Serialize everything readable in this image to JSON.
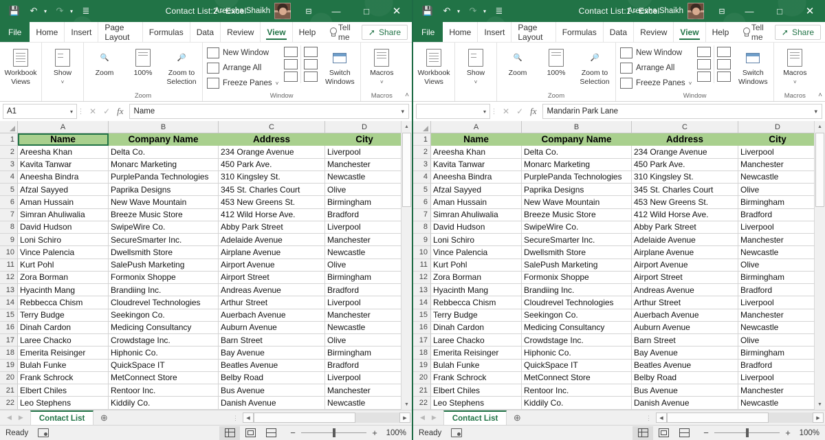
{
  "windows": [
    {
      "title": "Contact List:2  -  Excel",
      "user": "Areesha Shaikh",
      "name_box": "A1",
      "formula_value": "Name",
      "selected_cell": "A1"
    },
    {
      "title": "Contact List:1  -  Excel",
      "user": "Areesha Shaikh",
      "name_box": "",
      "formula_value": "Mandarin Park Lane",
      "selected_cell": ""
    }
  ],
  "quick_access": {
    "save_icon": "save-icon",
    "undo_icon": "undo-icon",
    "redo_icon": "redo-icon",
    "customize_icon": "customize-qat-icon"
  },
  "window_controls": {
    "ribbon_display_options": "ribbon-display-options-icon",
    "minimize": "—",
    "maximize": "□",
    "close": "✕"
  },
  "ribbon_tabs": [
    {
      "label": "File",
      "active": false
    },
    {
      "label": "Home",
      "active": false
    },
    {
      "label": "Insert",
      "active": false
    },
    {
      "label": "Page Layout",
      "active": false
    },
    {
      "label": "Formulas",
      "active": false
    },
    {
      "label": "Data",
      "active": false
    },
    {
      "label": "Review",
      "active": false
    },
    {
      "label": "View",
      "active": true
    },
    {
      "label": "Help",
      "active": false
    }
  ],
  "tell_me": "Tell me",
  "share_label": "Share",
  "ribbon_groups": {
    "workbook_views": {
      "label": "",
      "button": {
        "line1": "Workbook",
        "line2": "Views",
        "caret": "˅"
      }
    },
    "show": {
      "button": {
        "line1": "Show",
        "caret": "˅"
      }
    },
    "zoom": {
      "label": "Zoom",
      "buttons": [
        {
          "label": "Zoom"
        },
        {
          "label": "100%"
        },
        {
          "line1": "Zoom to",
          "line2": "Selection"
        }
      ]
    },
    "window": {
      "label": "Window",
      "small_buttons": [
        {
          "label": "New Window"
        },
        {
          "label": "Arrange All"
        },
        {
          "label": "Freeze Panes",
          "caret": "˅"
        }
      ],
      "switch_windows": {
        "line1": "Switch",
        "line2": "Windows",
        "caret": "˅"
      }
    },
    "macros": {
      "label": "Macros",
      "button": {
        "line1": "Macros",
        "caret": "˅"
      }
    }
  },
  "collapse_ribbon": "˄",
  "sheet": {
    "columns": [
      "A",
      "B",
      "C",
      "D"
    ],
    "headers": [
      "Name",
      "Company Name",
      "Address",
      "City"
    ],
    "rows": [
      {
        "n": 2,
        "cells": [
          "Areesha Khan",
          "Delta Co.",
          "234 Orange Avenue",
          "Liverpool"
        ]
      },
      {
        "n": 3,
        "cells": [
          "Kavita Tanwar",
          "Monarc Marketing",
          "450 Park Ave.",
          "Manchester"
        ]
      },
      {
        "n": 4,
        "cells": [
          "Aneesha Bindra",
          "PurplePanda Technologies",
          "310 Kingsley St.",
          "Newcastle"
        ]
      },
      {
        "n": 5,
        "cells": [
          "Afzal Sayyed",
          "Paprika Designs",
          "345 St. Charles Court",
          "Olive"
        ]
      },
      {
        "n": 6,
        "cells": [
          "Aman Hussain",
          "New Wave Mountain",
          "453 New Greens St.",
          "Birmingham"
        ]
      },
      {
        "n": 7,
        "cells": [
          "Simran Ahuliwalia",
          "Breeze Music Store",
          "412 Wild Horse Ave.",
          "Bradford"
        ]
      },
      {
        "n": 8,
        "cells": [
          "David Hudson",
          "SwipeWire Co.",
          "Abby Park Street",
          "Liverpool"
        ]
      },
      {
        "n": 9,
        "cells": [
          "Loni Schiro",
          "SecureSmarter Inc.",
          "Adelaide Avenue",
          "Manchester"
        ]
      },
      {
        "n": 10,
        "cells": [
          "Vince Palencia",
          "Dwellsmith Store",
          "Airplane Avenue",
          "Newcastle"
        ]
      },
      {
        "n": 11,
        "cells": [
          "Kurt Pohl",
          "SalePush Marketing",
          "Airport Avenue",
          "Olive"
        ]
      },
      {
        "n": 12,
        "cells": [
          "Zora Borman",
          "Formonix Shoppe",
          "Airport Street",
          "Birmingham"
        ]
      },
      {
        "n": 13,
        "cells": [
          "Hyacinth Mang",
          "Brandiing Inc.",
          "Andreas Avenue",
          "Bradford"
        ]
      },
      {
        "n": 14,
        "cells": [
          "Rebbecca Chism",
          "Cloudrevel Technologies",
          "Arthur Street",
          "Liverpool"
        ]
      },
      {
        "n": 15,
        "cells": [
          "Terry Budge",
          "Seekingon Co.",
          "Auerbach Avenue",
          "Manchester"
        ]
      },
      {
        "n": 16,
        "cells": [
          "Dinah Cardon",
          "Medicing Consultancy",
          "Auburn Avenue",
          "Newcastle"
        ]
      },
      {
        "n": 17,
        "cells": [
          "Laree Chacko",
          "Crowdstage Inc.",
          "Barn Street",
          "Olive"
        ]
      },
      {
        "n": 18,
        "cells": [
          "Emerita Reisinger",
          "Hiphonic Co.",
          "Bay Avenue",
          "Birmingham"
        ]
      },
      {
        "n": 19,
        "cells": [
          "Bulah Funke",
          "QuickSpace IT",
          "Beatles Avenue",
          "Bradford"
        ]
      },
      {
        "n": 20,
        "cells": [
          "Frank Schrock",
          "MetConnect Store",
          "Belby Road",
          "Liverpool"
        ]
      },
      {
        "n": 21,
        "cells": [
          "Elbert Chiles",
          "Rentoor Inc.",
          "Bus Avenue",
          "Manchester"
        ]
      },
      {
        "n": 22,
        "cells": [
          "Leo Stephens",
          "Kiddily Co.",
          "Danish Avenue",
          "Newcastle"
        ]
      }
    ]
  },
  "sheet_tabs": {
    "tabs": [
      "Contact List"
    ],
    "add_label": "⊕",
    "prev_arrow": "◀",
    "next_arrow": "▶"
  },
  "status_bar": {
    "status": "Ready",
    "macro_record_icon": "record-macro-icon",
    "views": [
      {
        "name": "normal-view",
        "active": true
      },
      {
        "name": "page-layout-view",
        "active": false
      },
      {
        "name": "page-break-preview",
        "active": false
      }
    ],
    "zoom_out": "−",
    "zoom_in": "+",
    "zoom_level": "100%"
  },
  "colors": {
    "excel_green": "#217346",
    "header_fill": "#a9d08e",
    "accent_orange": "#e07b39"
  }
}
